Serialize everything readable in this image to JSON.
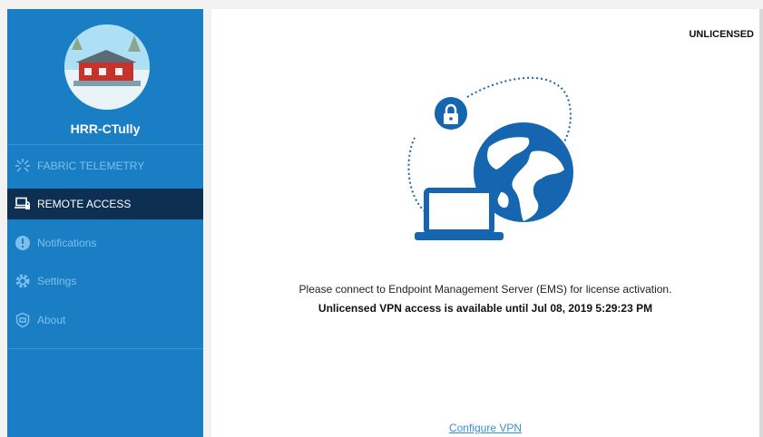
{
  "sidebar": {
    "username": "HRR-CTully",
    "items": [
      {
        "label": "FABRIC TELEMETRY",
        "icon": "fabric-telemetry-icon"
      },
      {
        "label": "REMOTE ACCESS",
        "icon": "laptop-lock-icon",
        "active": true
      },
      {
        "label": "Notifications",
        "icon": "exclamation-circle-icon"
      },
      {
        "label": "Settings",
        "icon": "gear-icon"
      },
      {
        "label": "About",
        "icon": "shield-icon"
      }
    ]
  },
  "main": {
    "license_status": "UNLICENSED",
    "message": "Please connect to Endpoint Management Server (EMS) for license activation.",
    "vpn_notice": "Unlicensed VPN access is available until Jul 08, 2019 5:29:23 PM",
    "configure_link": "Configure VPN"
  },
  "colors": {
    "sidebar_bg": "#1a7ec4",
    "active_item_bg": "#0c2f52",
    "inactive_text": "#7cc0ea",
    "accent": "#1565b0",
    "link": "#3a8fd6"
  }
}
